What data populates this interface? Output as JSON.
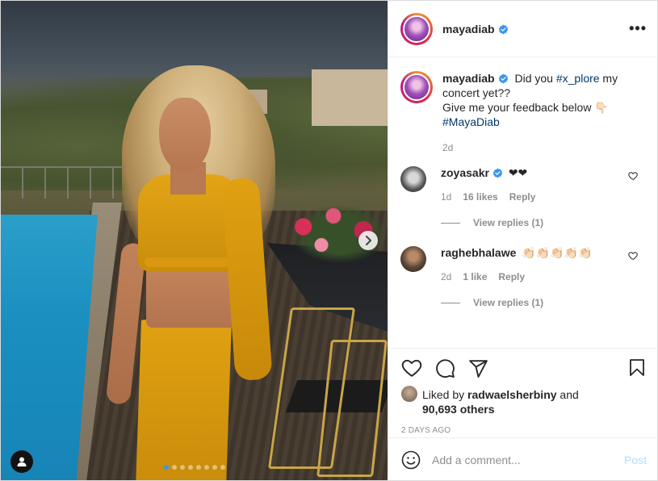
{
  "post": {
    "username": "mayadiab",
    "more_label": "•••",
    "caption_prefix": "Did you ",
    "caption_hashtag1": "#x_plore",
    "caption_mid": " my concert yet??",
    "caption_line2": "Give me your feedback below 👇🏻",
    "caption_hashtag2": "#MayaDiab",
    "caption_age": "2d",
    "carousel_dots": 8,
    "carousel_active": 1
  },
  "comments": [
    {
      "username": "zoyasakr",
      "verified": true,
      "text": "❤❤",
      "age": "1d",
      "likes": "16 likes",
      "reply_label": "Reply",
      "view_replies": "View replies (1)"
    },
    {
      "username": "raghebhalawe",
      "verified": false,
      "text": "👏🏻👏🏻👏🏻👏🏻👏🏻",
      "age": "2d",
      "likes": "1 like",
      "reply_label": "Reply",
      "view_replies": "View replies (1)"
    }
  ],
  "likes": {
    "prefix": "Liked by ",
    "user": "radwaelsherbiny",
    "and": " and",
    "others": "90,693 others"
  },
  "timestamp": "2 DAYS AGO",
  "add_comment": {
    "placeholder": "Add a comment...",
    "post_label": "Post"
  },
  "icons": {
    "verified": "verified-badge-icon",
    "heart": "heart-icon",
    "comment": "comment-icon",
    "share": "share-icon",
    "bookmark": "bookmark-icon",
    "emoji": "emoji-icon",
    "next": "chevron-right-icon",
    "tag": "user-tag-icon"
  },
  "colors": {
    "verified_blue": "#3897f0",
    "link": "#00376b",
    "muted": "#8e8e8e",
    "post_disabled": "#b2dffc"
  }
}
